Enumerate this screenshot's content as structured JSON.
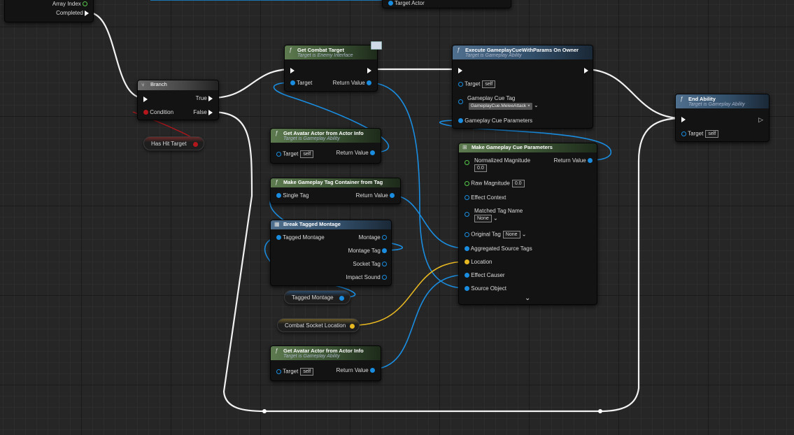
{
  "top_fragment": {
    "label1": "Array Index",
    "completed": "Completed",
    "target_actor": "Target Actor"
  },
  "branch": {
    "title": "Branch",
    "true": "True",
    "false": "False",
    "condition": "Condition"
  },
  "has_hit_target": "Has Hit Target",
  "get_combat_target": {
    "title": "Get Combat Target",
    "subtitle": "Target is Enemy Interface",
    "target": "Target",
    "return": "Return Value"
  },
  "avatar1": {
    "title": "Get Avatar Actor from Actor Info",
    "subtitle": "Target is Gameplay Ability",
    "target": "Target",
    "self": "self",
    "return": "Return Value"
  },
  "make_tag_container": {
    "title": "Make Gameplay Tag Container from Tag",
    "single_tag": "Single Tag",
    "return": "Return Value"
  },
  "break_montage": {
    "title": "Break Tagged Montage",
    "tagged_montage": "Tagged Montage",
    "montage": "Montage",
    "montage_tag": "Montage Tag",
    "socket_tag": "Socket Tag",
    "impact_sound": "Impact Sound"
  },
  "tagged_montage_var": "Tagged Montage",
  "combat_socket_var": "Combat Socket Location",
  "avatar2": {
    "title": "Get Avatar Actor from Actor Info",
    "subtitle": "Target is Gameplay Ability",
    "target": "Target",
    "self": "self",
    "return": "Return Value"
  },
  "execute_cue": {
    "title": "Execute GameplayCueWithParams On Owner",
    "subtitle": "Target is Gameplay Ability",
    "target": "Target",
    "self": "self",
    "cue_tag": "Gameplay Cue Tag",
    "cue_tag_value": "GameplayCue.MeleeAttack",
    "cue_params": "Gameplay Cue Parameters"
  },
  "make_params": {
    "title": "Make Gameplay Cue Parameters",
    "normalized": "Normalized Magnitude",
    "normalized_val": "0.0",
    "return": "Return Value",
    "raw": "Raw Magnitude",
    "raw_val": "0.0",
    "effect_context": "Effect Context",
    "matched": "Matched Tag Name",
    "matched_val": "None",
    "original": "Original Tag",
    "original_val": "None",
    "aggregated": "Aggregated Source Tags",
    "location": "Location",
    "causer": "Effect Causer",
    "source": "Source Object"
  },
  "end_ability": {
    "title": "End Ability",
    "subtitle": "Target is Gameplay Ability",
    "target": "Target",
    "self": "self"
  },
  "colors": {
    "exec": "#ffffff",
    "object": "#1a8de0",
    "vector": "#e8b822",
    "bool": "#b3161b",
    "struct": "#56c74b"
  }
}
